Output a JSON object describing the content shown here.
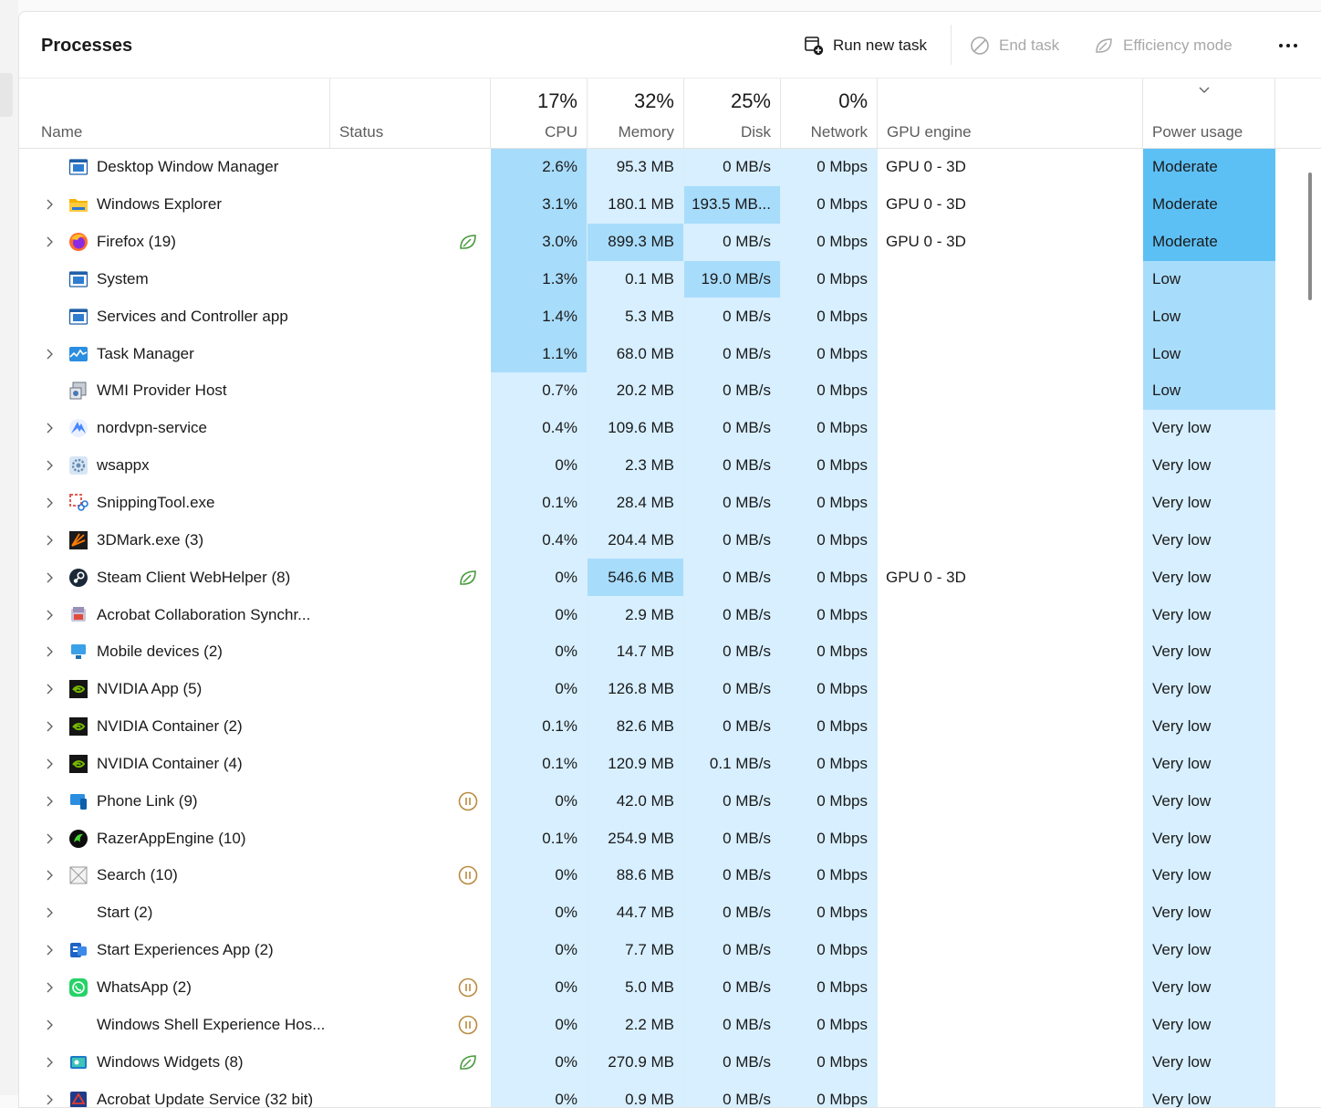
{
  "toolbar": {
    "title": "Processes",
    "run_new_task": "Run new task",
    "end_task": "End task",
    "efficiency_mode": "Efficiency mode"
  },
  "columns": {
    "name": "Name",
    "status": "Status",
    "cpu": {
      "label": "CPU",
      "pct": "17%"
    },
    "memory": {
      "label": "Memory",
      "pct": "32%"
    },
    "disk": {
      "label": "Disk",
      "pct": "25%"
    },
    "network": {
      "label": "Network",
      "pct": "0%"
    },
    "gpu_engine": "GPU engine",
    "power_usage": "Power usage"
  },
  "colors": {
    "heat_light": "#d7efff",
    "heat_mid": "#a8dcfb",
    "heat_strong": "#7bc9f5",
    "heat_max": "#5dc0f5"
  },
  "processes": [
    {
      "expandable": false,
      "icon": "window-system-icon",
      "name": "Desktop Window Manager",
      "status": "",
      "cpu": "2.6%",
      "memory": "95.3 MB",
      "disk": "0 MB/s",
      "network": "0 Mbps",
      "gpu": "GPU 0 - 3D",
      "power": "Moderate"
    },
    {
      "expandable": true,
      "icon": "folder-icon",
      "name": "Windows Explorer",
      "status": "",
      "cpu": "3.1%",
      "memory": "180.1 MB",
      "disk": "193.5 MB...",
      "network": "0 Mbps",
      "gpu": "GPU 0 - 3D",
      "power": "Moderate"
    },
    {
      "expandable": true,
      "icon": "firefox-icon",
      "name": "Firefox (19)",
      "status": "efficiency",
      "cpu": "3.0%",
      "memory": "899.3 MB",
      "disk": "0 MB/s",
      "network": "0 Mbps",
      "gpu": "GPU 0 - 3D",
      "power": "Moderate"
    },
    {
      "expandable": false,
      "icon": "window-system-icon",
      "name": "System",
      "status": "",
      "cpu": "1.3%",
      "memory": "0.1 MB",
      "disk": "19.0 MB/s",
      "network": "0 Mbps",
      "gpu": "",
      "power": "Low"
    },
    {
      "expandable": false,
      "icon": "window-system-icon",
      "name": "Services and Controller app",
      "status": "",
      "cpu": "1.4%",
      "memory": "5.3 MB",
      "disk": "0 MB/s",
      "network": "0 Mbps",
      "gpu": "",
      "power": "Low"
    },
    {
      "expandable": true,
      "icon": "task-manager-icon",
      "name": "Task Manager",
      "status": "",
      "cpu": "1.1%",
      "memory": "68.0 MB",
      "disk": "0 MB/s",
      "network": "0 Mbps",
      "gpu": "",
      "power": "Low"
    },
    {
      "expandable": false,
      "icon": "wmi-icon",
      "name": "WMI Provider Host",
      "status": "",
      "cpu": "0.7%",
      "memory": "20.2 MB",
      "disk": "0 MB/s",
      "network": "0 Mbps",
      "gpu": "",
      "power": "Low"
    },
    {
      "expandable": true,
      "icon": "nordvpn-icon",
      "name": "nordvpn-service",
      "status": "",
      "cpu": "0.4%",
      "memory": "109.6 MB",
      "disk": "0 MB/s",
      "network": "0 Mbps",
      "gpu": "",
      "power": "Very low"
    },
    {
      "expandable": true,
      "icon": "gear-icon",
      "name": "wsappx",
      "status": "",
      "cpu": "0%",
      "memory": "2.3 MB",
      "disk": "0 MB/s",
      "network": "0 Mbps",
      "gpu": "",
      "power": "Very low"
    },
    {
      "expandable": true,
      "icon": "snipping-tool-icon",
      "name": "SnippingTool.exe",
      "status": "",
      "cpu": "0.1%",
      "memory": "28.4 MB",
      "disk": "0 MB/s",
      "network": "0 Mbps",
      "gpu": "",
      "power": "Very low"
    },
    {
      "expandable": true,
      "icon": "3dmark-icon",
      "name": "3DMark.exe (3)",
      "status": "",
      "cpu": "0.4%",
      "memory": "204.4 MB",
      "disk": "0 MB/s",
      "network": "0 Mbps",
      "gpu": "",
      "power": "Very low"
    },
    {
      "expandable": true,
      "icon": "steam-icon",
      "name": "Steam Client WebHelper (8)",
      "status": "efficiency",
      "cpu": "0%",
      "memory": "546.6 MB",
      "disk": "0 MB/s",
      "network": "0 Mbps",
      "gpu": "GPU 0 - 3D",
      "power": "Very low"
    },
    {
      "expandable": true,
      "icon": "acrobat-sync-icon",
      "name": "Acrobat Collaboration Synchr...",
      "status": "",
      "cpu": "0%",
      "memory": "2.9 MB",
      "disk": "0 MB/s",
      "network": "0 Mbps",
      "gpu": "",
      "power": "Very low"
    },
    {
      "expandable": true,
      "icon": "mobile-devices-icon",
      "name": "Mobile devices (2)",
      "status": "",
      "cpu": "0%",
      "memory": "14.7 MB",
      "disk": "0 MB/s",
      "network": "0 Mbps",
      "gpu": "",
      "power": "Very low"
    },
    {
      "expandable": true,
      "icon": "nvidia-icon",
      "name": "NVIDIA App (5)",
      "status": "",
      "cpu": "0%",
      "memory": "126.8 MB",
      "disk": "0 MB/s",
      "network": "0 Mbps",
      "gpu": "",
      "power": "Very low"
    },
    {
      "expandable": true,
      "icon": "nvidia-icon",
      "name": "NVIDIA Container (2)",
      "status": "",
      "cpu": "0.1%",
      "memory": "82.6 MB",
      "disk": "0 MB/s",
      "network": "0 Mbps",
      "gpu": "",
      "power": "Very low"
    },
    {
      "expandable": true,
      "icon": "nvidia-icon",
      "name": "NVIDIA Container (4)",
      "status": "",
      "cpu": "0.1%",
      "memory": "120.9 MB",
      "disk": "0.1 MB/s",
      "network": "0 Mbps",
      "gpu": "",
      "power": "Very low"
    },
    {
      "expandable": true,
      "icon": "phone-link-icon",
      "name": "Phone Link (9)",
      "status": "suspended",
      "cpu": "0%",
      "memory": "42.0 MB",
      "disk": "0 MB/s",
      "network": "0 Mbps",
      "gpu": "",
      "power": "Very low"
    },
    {
      "expandable": true,
      "icon": "razer-icon",
      "name": "RazerAppEngine (10)",
      "status": "",
      "cpu": "0.1%",
      "memory": "254.9 MB",
      "disk": "0 MB/s",
      "network": "0 Mbps",
      "gpu": "",
      "power": "Very low"
    },
    {
      "expandable": true,
      "icon": "search-placeholder-icon",
      "name": "Search (10)",
      "status": "suspended",
      "cpu": "0%",
      "memory": "88.6 MB",
      "disk": "0 MB/s",
      "network": "0 Mbps",
      "gpu": "",
      "power": "Very low"
    },
    {
      "expandable": true,
      "icon": "",
      "name": "Start (2)",
      "status": "",
      "cpu": "0%",
      "memory": "44.7 MB",
      "disk": "0 MB/s",
      "network": "0 Mbps",
      "gpu": "",
      "power": "Very low"
    },
    {
      "expandable": true,
      "icon": "start-experiences-icon",
      "name": "Start Experiences App (2)",
      "status": "",
      "cpu": "0%",
      "memory": "7.7 MB",
      "disk": "0 MB/s",
      "network": "0 Mbps",
      "gpu": "",
      "power": "Very low"
    },
    {
      "expandable": true,
      "icon": "whatsapp-icon",
      "name": "WhatsApp (2)",
      "status": "suspended",
      "cpu": "0%",
      "memory": "5.0 MB",
      "disk": "0 MB/s",
      "network": "0 Mbps",
      "gpu": "",
      "power": "Very low"
    },
    {
      "expandable": true,
      "icon": "",
      "name": "Windows Shell Experience Hos...",
      "status": "suspended",
      "cpu": "0%",
      "memory": "2.2 MB",
      "disk": "0 MB/s",
      "network": "0 Mbps",
      "gpu": "",
      "power": "Very low"
    },
    {
      "expandable": true,
      "icon": "widgets-icon",
      "name": "Windows Widgets (8)",
      "status": "efficiency",
      "cpu": "0%",
      "memory": "270.9 MB",
      "disk": "0 MB/s",
      "network": "0 Mbps",
      "gpu": "",
      "power": "Very low"
    },
    {
      "expandable": true,
      "icon": "acrobat-update-icon",
      "name": "Acrobat Update Service (32 bit)",
      "status": "",
      "cpu": "0%",
      "memory": "0.9 MB",
      "disk": "0 MB/s",
      "network": "0 Mbps",
      "gpu": "",
      "power": "Very low"
    }
  ]
}
